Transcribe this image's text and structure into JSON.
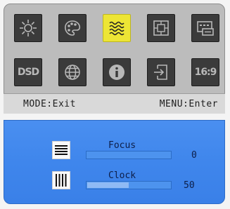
{
  "menu": {
    "icons": [
      {
        "name": "brightness-icon",
        "selected": false
      },
      {
        "name": "color-palette-icon",
        "selected": false
      },
      {
        "name": "wave-icon",
        "selected": true
      },
      {
        "name": "position-icon",
        "selected": false
      },
      {
        "name": "osd-settings-icon",
        "selected": false
      },
      {
        "name": "dsd-icon",
        "text": "DSD",
        "selected": false
      },
      {
        "name": "language-globe-icon",
        "selected": false
      },
      {
        "name": "info-icon",
        "selected": false
      },
      {
        "name": "input-source-icon",
        "selected": false
      },
      {
        "name": "aspect-ratio-icon",
        "text": "16:9",
        "selected": false
      }
    ],
    "hint_left": "MODE:Exit",
    "hint_right": "MENU:Enter"
  },
  "params": [
    {
      "label": "Focus",
      "value": "0",
      "level": 0
    },
    {
      "label": "Clock",
      "value": "50",
      "level": 50
    }
  ],
  "colors": {
    "selected_tile": "#ede535",
    "tile": "#3b3b3b",
    "panel_blue": "#4a8ff0"
  }
}
